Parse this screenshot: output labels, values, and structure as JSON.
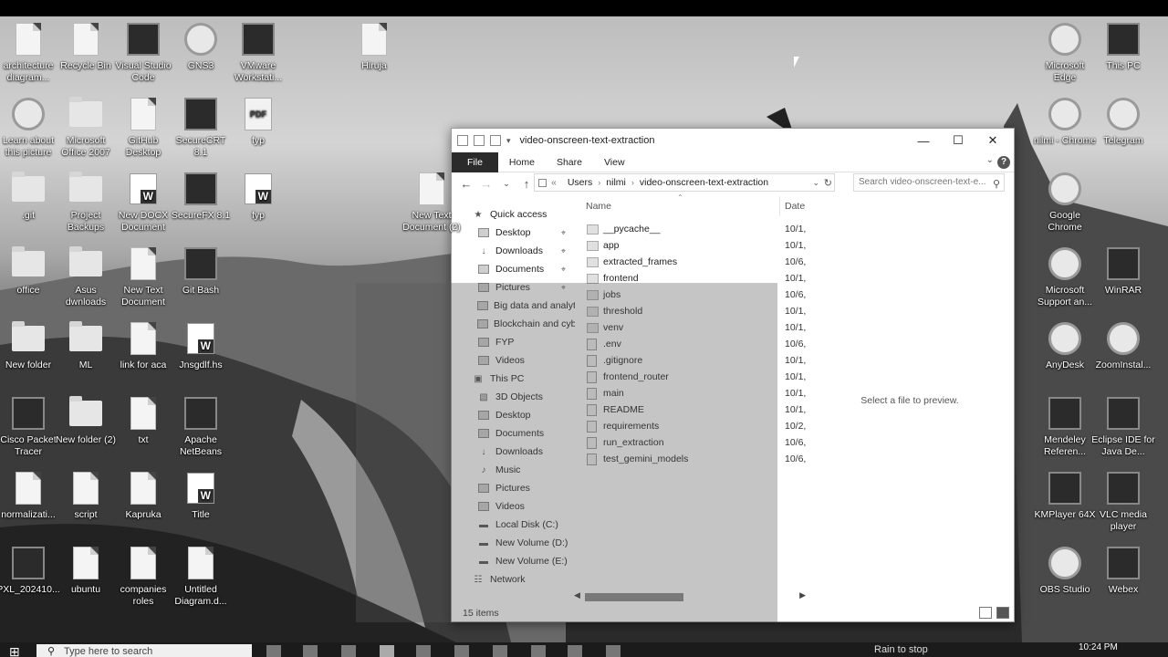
{
  "desktop": {
    "icons_left": [
      {
        "label": "architecture diagram...",
        "icon": "doc-icon"
      },
      {
        "label": "Recycle Bin",
        "icon": "recycle-bin-icon"
      },
      {
        "label": "Visual Studio Code",
        "icon": "vscode-icon"
      },
      {
        "label": "GNS3",
        "icon": "gns3-icon"
      },
      {
        "label": "VMware Workstati...",
        "icon": "vmware-icon"
      },
      {
        "label": "Hiruja",
        "icon": "doc-icon"
      },
      {
        "label": "Learn about this picture",
        "icon": "camera-icon"
      },
      {
        "label": "Microsoft Office 2007",
        "icon": "folder-icon"
      },
      {
        "label": "GitHub Desktop",
        "icon": "doc-icon"
      },
      {
        "label": "SecureCRT 8.1",
        "icon": "securecrt-icon"
      },
      {
        "label": "fyp",
        "icon": "pdf-icon"
      },
      {
        "label": ".git",
        "icon": "folder-icon"
      },
      {
        "label": "Project Backups",
        "icon": "folder-icon"
      },
      {
        "label": "New DOCX Document",
        "icon": "word-icon"
      },
      {
        "label": "SecureFX 8.1",
        "icon": "securefx-icon"
      },
      {
        "label": "fyp",
        "icon": "word-icon"
      },
      {
        "label": "New Text Document (2)",
        "icon": "doc-icon"
      },
      {
        "label": "office",
        "icon": "folder-icon"
      },
      {
        "label": "Asus dwnloads",
        "icon": "folder-icon"
      },
      {
        "label": "New Text Document",
        "icon": "doc-icon"
      },
      {
        "label": "Git Bash",
        "icon": "git-bash-icon"
      },
      {
        "label": "New folder",
        "icon": "folder-icon"
      },
      {
        "label": "ML",
        "icon": "folder-icon"
      },
      {
        "label": "link for aca",
        "icon": "doc-icon"
      },
      {
        "label": "Jnsgdlf.hs",
        "icon": "word-icon"
      },
      {
        "label": "Cisco Packet Tracer",
        "icon": "cisco-icon"
      },
      {
        "label": "New folder (2)",
        "icon": "folder-icon"
      },
      {
        "label": "txt",
        "icon": "doc-icon"
      },
      {
        "label": "Apache NetBeans",
        "icon": "netbeans-icon"
      },
      {
        "label": "normalizati...",
        "icon": "doc-icon"
      },
      {
        "label": "script",
        "icon": "doc-icon"
      },
      {
        "label": "Kapruka",
        "icon": "doc-icon"
      },
      {
        "label": "Title",
        "icon": "word-icon"
      },
      {
        "label": "PXL_202410...",
        "icon": "video-icon"
      },
      {
        "label": "ubuntu",
        "icon": "doc-icon"
      },
      {
        "label": "companies roles",
        "icon": "doc-icon"
      },
      {
        "label": "Untitled Diagram.d...",
        "icon": "doc-icon"
      }
    ],
    "icons_right": [
      {
        "label": "Microsoft Edge",
        "icon": "edge-icon"
      },
      {
        "label": "This PC",
        "icon": "computer-icon"
      },
      {
        "label": "nilmi - Chrome",
        "icon": "chrome-icon"
      },
      {
        "label": "Telegram",
        "icon": "telegram-icon"
      },
      {
        "label": "Google Chrome",
        "icon": "chrome-icon"
      },
      {
        "label": "Microsoft Support an...",
        "icon": "help-icon"
      },
      {
        "label": "WinRAR",
        "icon": "winrar-icon"
      },
      {
        "label": "AnyDesk",
        "icon": "anydesk-icon"
      },
      {
        "label": "ZoomInstal...",
        "icon": "zoom-icon"
      },
      {
        "label": "Mendeley Referen...",
        "icon": "mendeley-icon"
      },
      {
        "label": "Eclipse IDE for Java De...",
        "icon": "eclipse-icon"
      },
      {
        "label": "KMPlayer 64X",
        "icon": "kmplayer-icon"
      },
      {
        "label": "VLC media player",
        "icon": "vlc-icon"
      },
      {
        "label": "OBS Studio",
        "icon": "obs-icon"
      },
      {
        "label": "Webex",
        "icon": "webex-icon"
      }
    ]
  },
  "explorer": {
    "title": "video-onscreen-text-extraction",
    "ribbon_tabs": [
      "File",
      "Home",
      "Share",
      "View"
    ],
    "breadcrumb": [
      "Users",
      "nilmi",
      "video-onscreen-text-extraction"
    ],
    "breadcrumb_prefix": "«",
    "search_placeholder": "Search video-onscreen-text-e...",
    "col_name": "Name",
    "col_date": "Date",
    "nav": [
      {
        "label": "Quick access",
        "level": 0,
        "icon": "star-icon",
        "pinned": false
      },
      {
        "label": "Desktop",
        "level": 1,
        "icon": "desktop-icon",
        "pinned": true
      },
      {
        "label": "Downloads",
        "level": 1,
        "icon": "download-icon",
        "pinned": true
      },
      {
        "label": "Documents",
        "level": 1,
        "icon": "documents-icon",
        "pinned": true
      },
      {
        "label": "Pictures",
        "level": 1,
        "icon": "pictures-icon",
        "pinned": true
      },
      {
        "label": "Big data and analyt",
        "level": 1,
        "icon": "folder-icon",
        "pinned": false
      },
      {
        "label": "Blockchain and cybe",
        "level": 1,
        "icon": "folder-icon",
        "pinned": false
      },
      {
        "label": "FYP",
        "level": 1,
        "icon": "folder-icon",
        "pinned": false
      },
      {
        "label": "Videos",
        "level": 1,
        "icon": "videos-icon",
        "pinned": false
      },
      {
        "label": "This PC",
        "level": 0,
        "icon": "computer-icon",
        "pinned": false
      },
      {
        "label": "3D Objects",
        "level": 1,
        "icon": "cube-icon",
        "pinned": false
      },
      {
        "label": "Desktop",
        "level": 1,
        "icon": "desktop-icon",
        "pinned": false
      },
      {
        "label": "Documents",
        "level": 1,
        "icon": "documents-icon",
        "pinned": false
      },
      {
        "label": "Downloads",
        "level": 1,
        "icon": "download-icon",
        "pinned": false
      },
      {
        "label": "Music",
        "level": 1,
        "icon": "music-icon",
        "pinned": false
      },
      {
        "label": "Pictures",
        "level": 1,
        "icon": "pictures-icon",
        "pinned": false
      },
      {
        "label": "Videos",
        "level": 1,
        "icon": "videos-icon",
        "pinned": false
      },
      {
        "label": "Local Disk (C:)",
        "level": 1,
        "icon": "drive-icon",
        "pinned": false
      },
      {
        "label": "New Volume (D:)",
        "level": 1,
        "icon": "drive-icon",
        "pinned": false
      },
      {
        "label": "New Volume (E:)",
        "level": 1,
        "icon": "drive-icon",
        "pinned": false
      },
      {
        "label": "Network",
        "level": 0,
        "icon": "network-icon",
        "pinned": false
      }
    ],
    "files": [
      {
        "name": "__pycache__",
        "date": "10/1,",
        "type": "folder"
      },
      {
        "name": "app",
        "date": "10/1,",
        "type": "folder"
      },
      {
        "name": "extracted_frames",
        "date": "10/6,",
        "type": "folder"
      },
      {
        "name": "frontend",
        "date": "10/1,",
        "type": "folder"
      },
      {
        "name": "jobs",
        "date": "10/6,",
        "type": "folder"
      },
      {
        "name": "threshold",
        "date": "10/1,",
        "type": "folder"
      },
      {
        "name": "venv",
        "date": "10/1,",
        "type": "folder"
      },
      {
        "name": ".env",
        "date": "10/6,",
        "type": "file"
      },
      {
        "name": ".gitignore",
        "date": "10/1,",
        "type": "file"
      },
      {
        "name": "frontend_router",
        "date": "10/1,",
        "type": "file"
      },
      {
        "name": "main",
        "date": "10/1,",
        "type": "file"
      },
      {
        "name": "README",
        "date": "10/1,",
        "type": "file"
      },
      {
        "name": "requirements",
        "date": "10/2,",
        "type": "file"
      },
      {
        "name": "run_extraction",
        "date": "10/6,",
        "type": "file"
      },
      {
        "name": "test_gemini_models",
        "date": "10/6,",
        "type": "file"
      }
    ],
    "preview_message": "Select a file to preview.",
    "status": "15 items"
  },
  "taskbar": {
    "search_placeholder": "Type here to search",
    "tray_text": "Rain to stop",
    "time": "10:24 PM"
  }
}
